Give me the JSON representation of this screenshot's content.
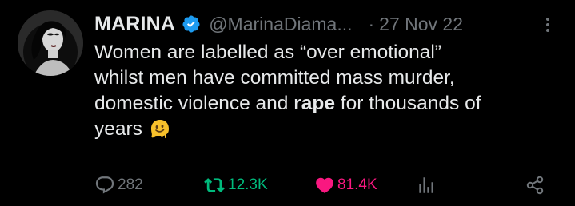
{
  "tweet": {
    "author_name": "MARINA",
    "handle": "@MarinaDiama...",
    "separator": "·",
    "date": "27 Nov 22",
    "text_line1": "Women are labelled as “over emotional”",
    "text_line2": "whilst men have committed mass murder,",
    "text_line3_before": "domestic violence and ",
    "text_line3_bold": "rape",
    "text_line3_after": " for thousands of",
    "text_line4": "years",
    "emoji": "melting-face"
  },
  "actions": {
    "replies": "282",
    "retweets": "12.3K",
    "likes": "81.4K"
  },
  "colors": {
    "background": "#000000",
    "text_primary": "#e7e9ea",
    "text_secondary": "#71767b",
    "verified": "#1d9bf0",
    "retweet_active": "#00ba7c",
    "like_active": "#f91880"
  },
  "icons": {
    "verified": "verified-badge-icon",
    "more": "more-options-icon",
    "reply": "reply-icon",
    "retweet": "retweet-icon",
    "like": "heart-icon",
    "views": "views-icon",
    "share": "share-icon"
  }
}
